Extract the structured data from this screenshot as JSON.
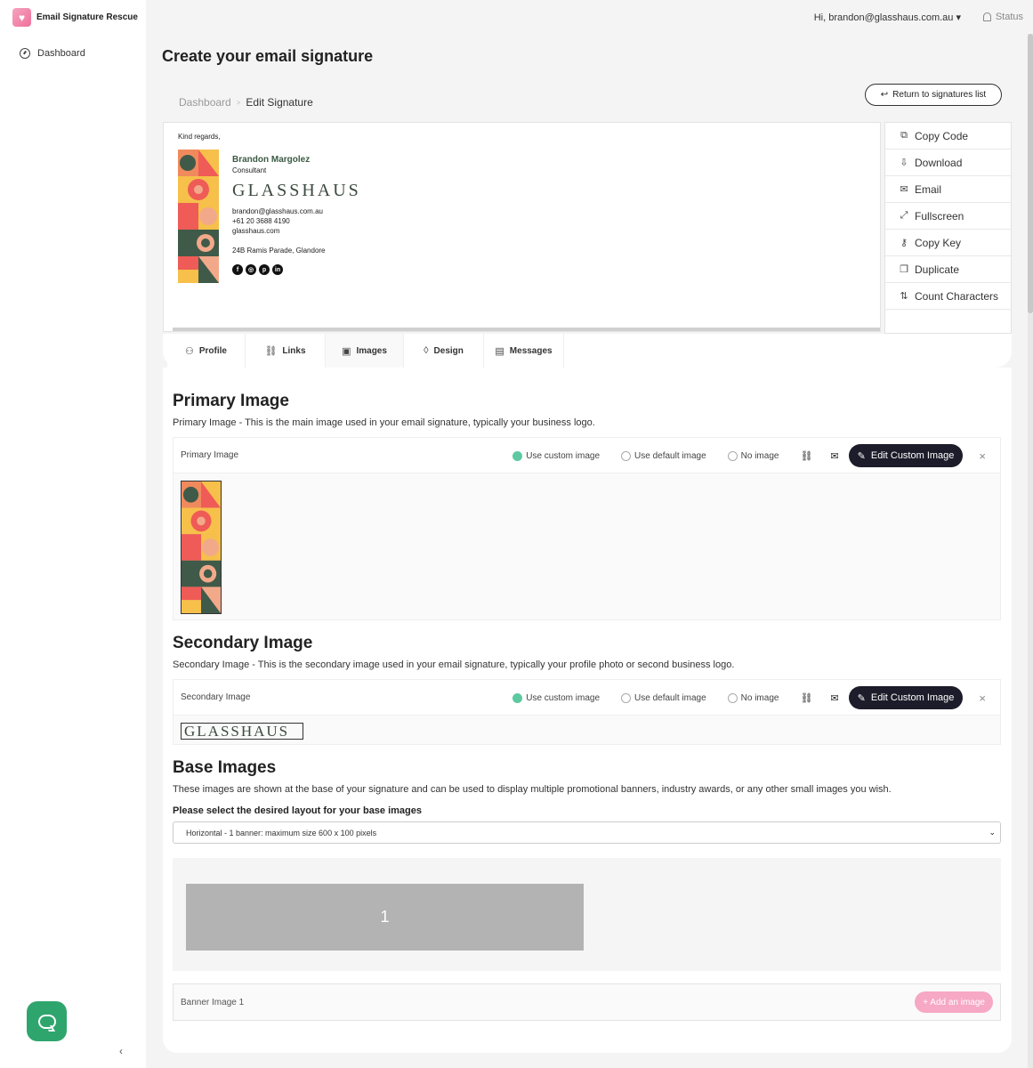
{
  "app": {
    "name": "Email Signature Rescue"
  },
  "sidebar": {
    "items": [
      {
        "label": "Dashboard",
        "icon": "dashboard-gauge-icon"
      }
    ],
    "collapse_glyph": "‹"
  },
  "topbar": {
    "user_greeting": "Hi, brandon@glasshaus.com.au",
    "status_label": "Status"
  },
  "page": {
    "title": "Create your email signature"
  },
  "breadcrumb": {
    "root": "Dashboard",
    "separator": ">",
    "current": "Edit Signature"
  },
  "return_button": {
    "label": "Return to signatures list"
  },
  "signature": {
    "greeting": "Kind regards,",
    "name": "Brandon Margolez",
    "title": "Consultant",
    "logo_text": "GLASSHAUS",
    "email": "brandon@glasshaus.com.au",
    "phone": "+61 20 3688 4190",
    "website": "glasshaus.com",
    "address": "24B Ramis Parade, Glandore",
    "socials": [
      {
        "icon": "facebook-icon",
        "glyph": "f"
      },
      {
        "icon": "instagram-icon",
        "glyph": "◎"
      },
      {
        "icon": "pinterest-icon",
        "glyph": "p"
      },
      {
        "icon": "linkedin-icon",
        "glyph": "in"
      }
    ]
  },
  "actions": [
    {
      "label": "Copy Code",
      "icon": "copy-code-icon",
      "glyph": "⧉"
    },
    {
      "label": "Download",
      "icon": "download-icon",
      "glyph": "⇩"
    },
    {
      "label": "Email",
      "icon": "email-icon",
      "glyph": "✉"
    },
    {
      "label": "Fullscreen",
      "icon": "fullscreen-icon",
      "glyph": "⤢"
    },
    {
      "label": "Copy Key",
      "icon": "key-icon",
      "glyph": "⚷"
    },
    {
      "label": "Duplicate",
      "icon": "duplicate-icon",
      "glyph": "❐"
    },
    {
      "label": "Count Characters",
      "icon": "count-characters-icon",
      "glyph": "⇅"
    }
  ],
  "tabs": [
    {
      "label": "Profile",
      "icon": "user-icon",
      "glyph": "⚇"
    },
    {
      "label": "Links",
      "icon": "link-icon",
      "glyph": "🔗"
    },
    {
      "label": "Images",
      "icon": "image-icon",
      "glyph": "▣"
    },
    {
      "label": "Design",
      "icon": "droplet-icon",
      "glyph": "◊"
    },
    {
      "label": "Messages",
      "icon": "message-icon",
      "glyph": "▤"
    }
  ],
  "active_tab": "Images",
  "primary": {
    "heading": "Primary Image",
    "description": "Primary Image - This is the main image used in your email signature, typically your business logo.",
    "box_label": "Primary Image"
  },
  "secondary": {
    "heading": "Secondary Image",
    "description": "Secondary Image - This is the secondary image used in your email signature, typically your profile photo or second business logo.",
    "box_label": "Secondary Image",
    "image_text": "GLASSHAUS"
  },
  "image_options": {
    "custom": "Use custom image",
    "default": "Use default image",
    "none": "No image",
    "selected": "custom",
    "edit_button": "Edit Custom Image",
    "close_glyph": "×"
  },
  "base": {
    "heading": "Base Images",
    "description": "These images are shown at the base of your signature and can be used to display multiple promotional banners, industry awards, or any other small images you wish.",
    "layout_label": "Please select the desired layout for your base images",
    "layout_value": "Horizontal - 1 banner: maximum size 600 x 100 pixels",
    "banner_slot": "1",
    "banner_row_label": "Banner Image 1",
    "add_button": "+ Add an image"
  },
  "colors": {
    "brand_pink": "#ef6f9a",
    "accent_green": "#5cc9a1",
    "dark_button": "#1c1c2a",
    "chat_green": "#2fa56e"
  }
}
